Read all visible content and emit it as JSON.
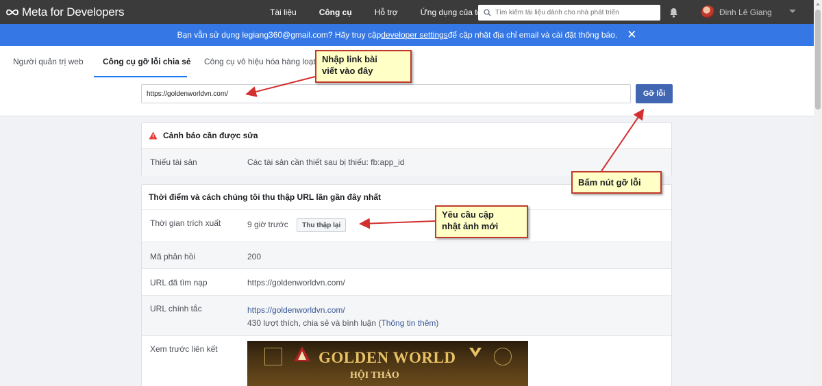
{
  "nav": {
    "logo": "Meta for Developers",
    "links": [
      "Tài liệu",
      "Công cụ",
      "Hỗ trợ",
      "Ứng dụng của tôi"
    ],
    "active_link": "Công cụ",
    "search_placeholder": "Tìm kiếm tài liệu dành cho nhà phát triển",
    "user_name": "Đinh Lê Giang"
  },
  "banner": {
    "text_before": "Bạn vẫn sử dụng legiang360@gmail.com? Hãy truy cập ",
    "link": "developer settings",
    "text_after": " để cập nhật địa chỉ email và cài đặt thông báo."
  },
  "tabs": [
    "Người quản trị web",
    "Công cụ gỡ lỗi chia sẻ",
    "Công cụ vô hiệu hóa hàng loạt"
  ],
  "debug": {
    "url_value": "https://goldenworldvn.com/",
    "button_label": "Gỡ lỗi"
  },
  "warnings": {
    "title": "Cảnh báo cần được sửa",
    "rows": [
      {
        "label": "Thiếu tài sản",
        "value": "Các tài sản cần thiết sau bị thiếu: fb:app_id"
      }
    ]
  },
  "scrape": {
    "title": "Thời điểm và cách chúng tôi thu thập URL lần gần đây nhất",
    "time_label": "Thời gian trích xuất",
    "time_value": "9 giờ trước",
    "recrawl_label": "Thu thập lại",
    "response_label": "Mã phản hồi",
    "response_value": "200",
    "fetched_label": "URL đã tìm nạp",
    "fetched_value": "https://goldenworldvn.com/",
    "canonical_label": "URL chính tắc",
    "canonical_value": "https://goldenworldvn.com/",
    "engagement_text": "430 lượt thích, chia sẻ và bình luận (",
    "more_info": "Thông tin thêm",
    "engagement_close": ")",
    "preview_label": "Xem trước liên kết",
    "preview_title": "GOLDEN WORLD",
    "preview_subtitle": "HỘI THẢO"
  },
  "annotations": {
    "input_hint": [
      "Nhập link bài",
      "viết vào đây"
    ],
    "button_hint": "Bấm nút gỡ lỗi",
    "recrawl_hint": [
      "Yêu cầu cập",
      "nhật ảnh mới"
    ]
  },
  "colors": {
    "nav_bg": "#3b3b3b",
    "banner_bg": "#3578e5",
    "primary_button": "#4267b2",
    "tab_underline": "#1877f2",
    "callout_border": "#c0392b",
    "callout_bg": "#ffffc6"
  }
}
